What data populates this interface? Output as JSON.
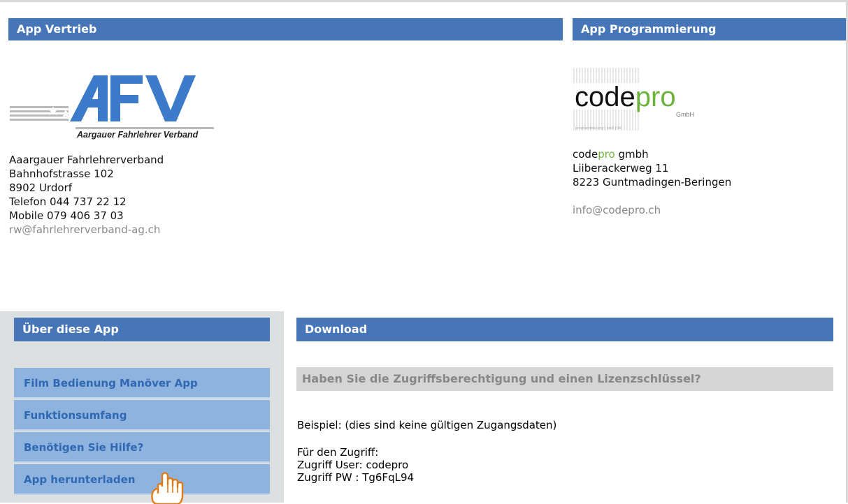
{
  "vertrieb": {
    "heading": "App Vertrieb",
    "logo": {
      "letters": "AFV",
      "caption": "Aargauer Fahrlehrer Verband"
    },
    "address": [
      "Aaargauer Fahrlehrerverband",
      "Bahnhofstrasse 102",
      "8902 Urdorf",
      "Telefon 044 737 22 12",
      "Mobile 079 406 37 03"
    ],
    "email": "rw@fahrlehrerverband-ag.ch"
  },
  "programmierung": {
    "heading": "App Programmierung",
    "logo": {
      "code": "code",
      "pro": "pro",
      "gmbh": "GmbH",
      "tagline": "programmierung | web | 3d"
    },
    "company_code": "code",
    "company_pro": "pro",
    "company_rest": " gmbh",
    "address": [
      "Liiberackerweg 11",
      "8223 Guntmadingen-Beringen"
    ],
    "email": "info@codepro.ch"
  },
  "sidebar": {
    "heading": "Über diese App",
    "items": [
      {
        "label": "Film Bedienung Manöver App"
      },
      {
        "label": "Funktionsumfang"
      },
      {
        "label": "Benötigen Sie Hilfe?"
      },
      {
        "label": "App herunterladen"
      }
    ]
  },
  "download": {
    "heading": "Download",
    "question": "Haben Sie die Zugriffsberechtigung und einen Lizenzschlüssel?",
    "example": "Beispiel: (dies sind keine gültigen Zugangsdaten)",
    "access_lines": [
      "Für den Zugriff:",
      "Zugriff User: codepro",
      "Zugriff PW : Tg6FqL94"
    ]
  },
  "colors": {
    "header_blue": "#4676b8",
    "nav_bg": "#8fb3df",
    "nav_text": "#2f68b3",
    "sidebar_bg": "#dcdfe0",
    "codepro_green": "#6cb33e",
    "question_bg": "#d5d5d5"
  },
  "icons": {
    "cursor": "hand-pointer-icon"
  }
}
